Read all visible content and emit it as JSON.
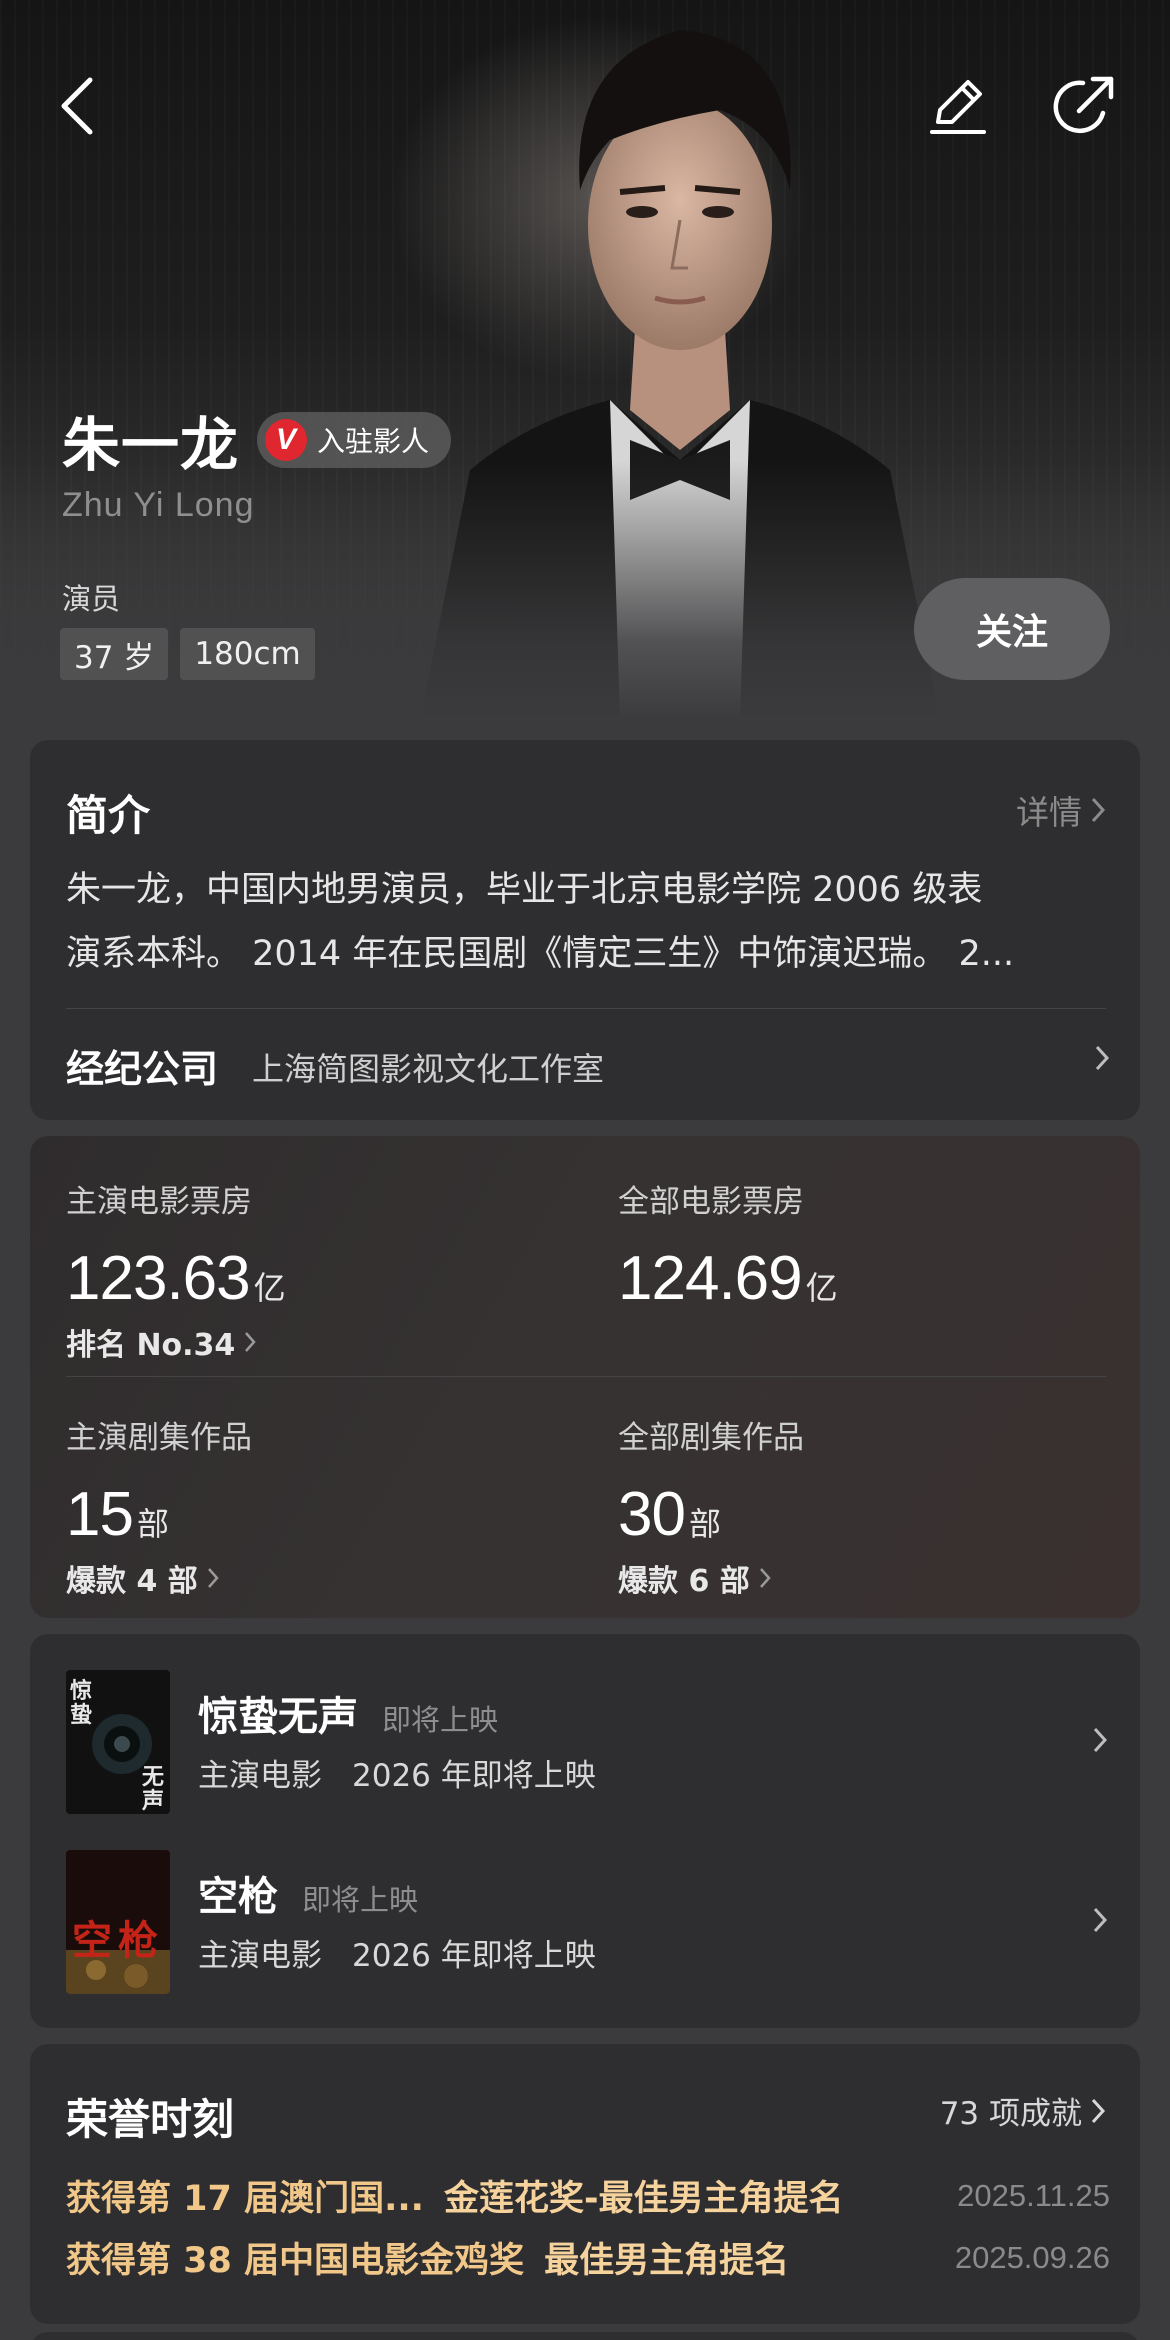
{
  "header": {
    "name": "朱一龙",
    "badge_v": "V",
    "badge_text": "入驻影人",
    "pinyin": "Zhu Yi Long",
    "role": "演员",
    "tags": [
      "37 岁",
      "180cm"
    ],
    "follow_label": "关注",
    "icons": {
      "back": "back-arrow-icon",
      "edit": "edit-pencil-icon",
      "share": "share-icon"
    }
  },
  "intro": {
    "title": "简介",
    "detail_label": "详情",
    "lines": [
      "朱一龙，中国内地男演员，毕业于北京电影学院 2006 级表",
      "演系本科。 2014 年在民国剧《情定三生》中饰演迟瑞。 2..."
    ],
    "agency_label": "经纪公司",
    "agency_value": "上海简图影视文化工作室"
  },
  "stats": {
    "lead_box": {
      "label": "主演电影票房",
      "value": "123.63",
      "unit": "亿",
      "sub": "排名 No.34"
    },
    "all_box": {
      "label": "全部电影票房",
      "value": "124.69",
      "unit": "亿"
    },
    "lead_series": {
      "label": "主演剧集作品",
      "value": "15",
      "unit": "部",
      "sub": "爆款 4 部"
    },
    "all_series": {
      "label": "全部剧集作品",
      "value": "30",
      "unit": "部",
      "sub": "爆款 6 部"
    }
  },
  "works": [
    {
      "title": "惊蛰无声",
      "status": "即将上映",
      "type": "主演电影",
      "release": "2026 年即将上映",
      "poster_text": "惊蛰无声"
    },
    {
      "title": "空枪",
      "status": "即将上映",
      "type": "主演电影",
      "release": "2026 年即将上映",
      "poster_text": "空枪"
    }
  ],
  "honors": {
    "title": "荣誉时刻",
    "count_label": "73 项成就",
    "items": [
      {
        "event": "获得第 17 届澳门国...",
        "award": "金莲花奖-最佳男主角提名",
        "date": "2025.11.25"
      },
      {
        "event": "获得第 38 届中国电影金鸡奖",
        "award": "最佳男主角提名",
        "date": "2025.09.26"
      }
    ]
  },
  "colors": {
    "background": "#3b3b3d",
    "card": "#2e2e30",
    "honor_gold": "#f1c889",
    "badge_red": "#e0262f"
  }
}
